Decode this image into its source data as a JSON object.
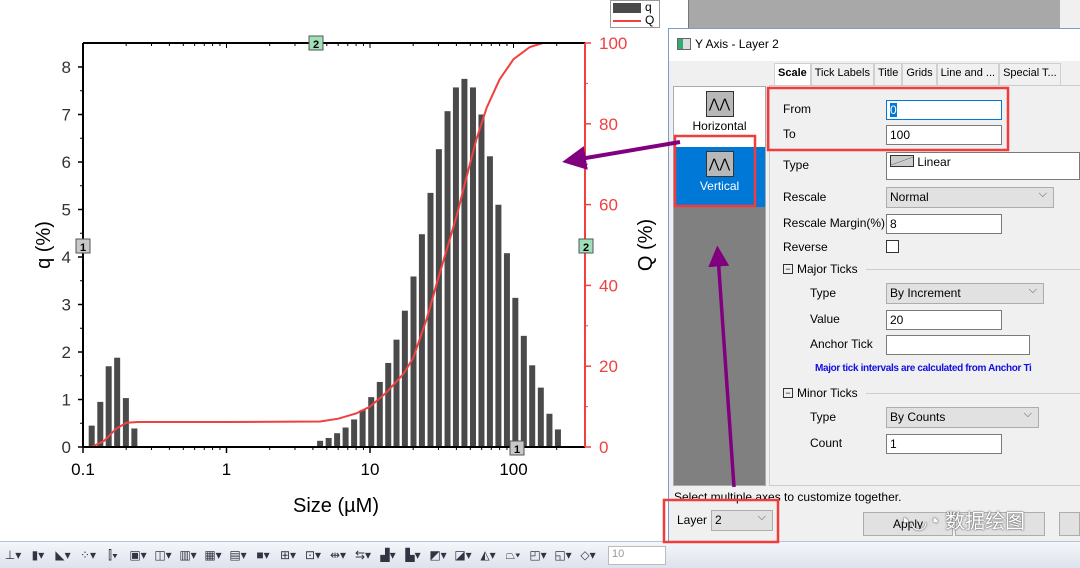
{
  "chart_data": {
    "type": "bar+line",
    "xlabel": "Size (µM)",
    "ylabel_left": "q (%)",
    "ylabel_right": "Q (%)",
    "x_scale": "log",
    "xlim": [
      0.1,
      300
    ],
    "ylim_left": [
      0,
      8.5
    ],
    "ylim_right": [
      0,
      100
    ],
    "x_ticks": [
      "0.1",
      "1",
      "10",
      "100"
    ],
    "y_ticks_left": [
      "0",
      "1",
      "2",
      "3",
      "4",
      "5",
      "6",
      "7",
      "8"
    ],
    "y_ticks_right": [
      "0",
      "20",
      "40",
      "60",
      "80",
      "100"
    ],
    "layer_markers": {
      "layer1": "1",
      "layer2": "2"
    },
    "legend": {
      "position": "top-right",
      "items": [
        "q",
        "Q"
      ]
    },
    "series": [
      {
        "name": "q",
        "type": "bar",
        "color": "#4a4a4a",
        "x": [
          0.115,
          0.132,
          0.151,
          0.173,
          0.199,
          0.228,
          4.49,
          5.15,
          5.9,
          6.76,
          7.75,
          8.88,
          10.2,
          11.7,
          13.4,
          15.3,
          17.5,
          20.1,
          23.0,
          26.4,
          30.2,
          34.7,
          39.7,
          45.5,
          52.2,
          59.8,
          68.5,
          78.5,
          90.0,
          103,
          118,
          135,
          155,
          178,
          204
        ],
        "values": [
          0.45,
          0.95,
          1.7,
          1.88,
          1.03,
          0.39,
          0.13,
          0.19,
          0.29,
          0.41,
          0.58,
          0.78,
          1.05,
          1.37,
          1.77,
          2.26,
          2.87,
          3.59,
          4.48,
          5.35,
          6.27,
          7.07,
          7.57,
          7.75,
          7.57,
          7.0,
          6.12,
          5.1,
          4.08,
          3.14,
          2.34,
          1.72,
          1.25,
          0.7,
          0.37
        ]
      },
      {
        "name": "Q",
        "type": "line",
        "color": "#f04040",
        "x": [
          0.115,
          0.14,
          0.17,
          0.2,
          0.24,
          1,
          4.5,
          6,
          8,
          10,
          13,
          17,
          20,
          25,
          30,
          35,
          40,
          48,
          55,
          65,
          80,
          100,
          130,
          160,
          200,
          250
        ],
        "values": [
          0,
          1.5,
          4.5,
          6,
          6.2,
          6.2,
          6.3,
          7,
          8.3,
          10,
          13.5,
          18,
          22,
          32,
          42,
          50,
          57,
          68,
          76,
          84,
          91,
          96,
          99,
          100,
          100,
          100
        ]
      }
    ]
  },
  "dialog": {
    "title": "Y Axis - Layer 2",
    "tabs": [
      "Scale",
      "Tick Labels",
      "Title",
      "Grids",
      "Line and ...",
      "Special T..."
    ],
    "axes": [
      {
        "label": "Horizontal",
        "selected": false
      },
      {
        "label": "Vertical",
        "selected": true
      }
    ],
    "from_label": "From",
    "from_value": "0",
    "to_label": "To",
    "to_value": "100",
    "type_label": "Type",
    "type_value": "Linear",
    "rescale_label": "Rescale",
    "rescale_value": "Normal",
    "rescale_margin_label": "Rescale Margin(%)",
    "rescale_margin_value": "8",
    "reverse_label": "Reverse",
    "reverse_checked": false,
    "major_ticks": {
      "header": "Major Ticks",
      "type_label": "Type",
      "type_value": "By Increment",
      "value_label": "Value",
      "value": "20",
      "anchor_label": "Anchor Tick",
      "anchor_value": "",
      "note": "Major tick intervals are calculated from Anchor Ti"
    },
    "minor_ticks": {
      "header": "Minor Ticks",
      "type_label": "Type",
      "type_value": "By Counts",
      "count_label": "Count",
      "count_value": "1"
    },
    "hint": "Select multiple axes to customize together.",
    "layer_label": "Layer",
    "layer_value": "2",
    "apply_label": "Apply"
  },
  "watermark": "数据绘图",
  "toolbar": {
    "icons": [
      "axis-icon",
      "bar-icon",
      "area-icon",
      "scatter-icon",
      "candlestick-icon",
      "3d-bar-icon",
      "3d-surface-icon",
      "3d-wall-icon",
      "grid-icon",
      "table-icon",
      "box-icon",
      "zoom-icon",
      "group-icon",
      "align-icon",
      "distribute-icon",
      "front-icon",
      "back-icon",
      "forward-icon",
      "backward-icon",
      "flip-icon",
      "perspective-icon",
      "fit-icon",
      "rotate-icon",
      "layer-icon"
    ],
    "font_size_value": "10"
  },
  "colors": {
    "accent": "#0078d7",
    "highlight_box": "#f03c3c",
    "arrow": "#800080",
    "q_axis": "#333333",
    "Q_axis": "#f04040"
  }
}
